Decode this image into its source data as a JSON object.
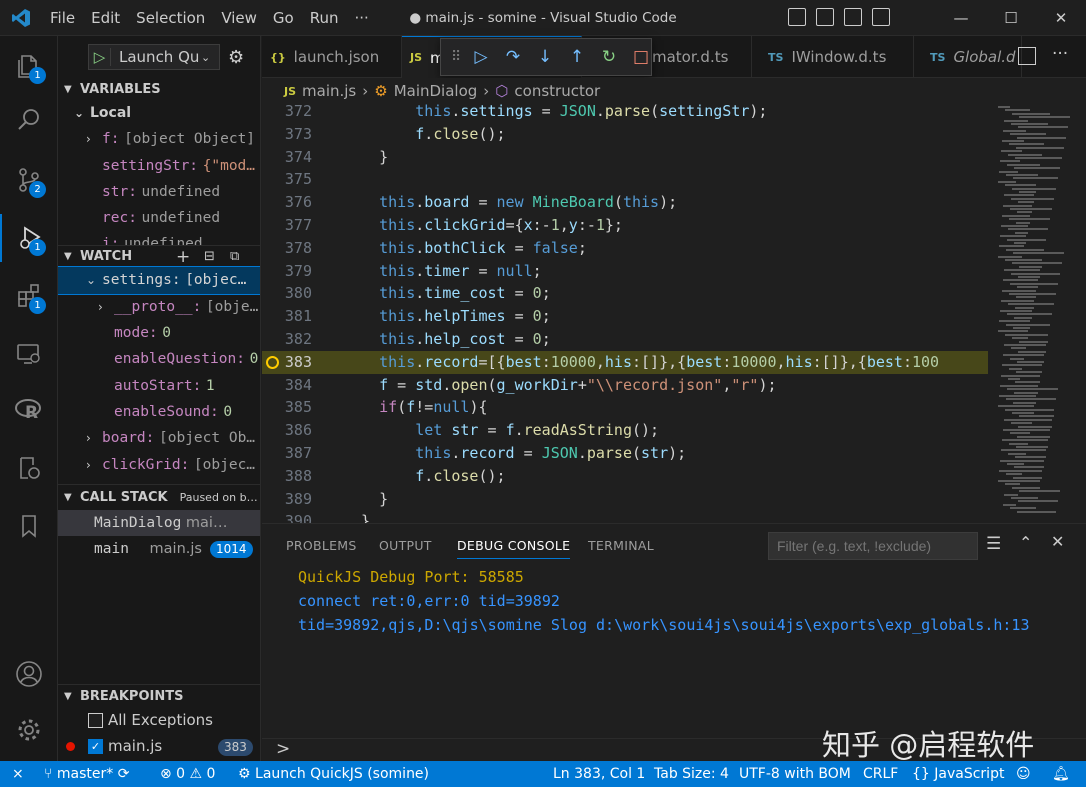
{
  "window": {
    "title": "● main.js - somine - Visual Studio Code",
    "menu": [
      "File",
      "Edit",
      "Selection",
      "View",
      "Go",
      "Run",
      "···"
    ]
  },
  "activity": {
    "explorer_badge": "1",
    "scm_badge": "2",
    "debug_badge": "1",
    "extensions_badge": "1"
  },
  "debug": {
    "launch_config": "Launch Qu"
  },
  "variables": {
    "header": "VARIABLES",
    "local_header": "Local",
    "rows": [
      {
        "name": "f:",
        "value": "[object Object]"
      },
      {
        "name": "settingStr:",
        "value": "{\"mod…"
      },
      {
        "name": "str:",
        "value": "undefined"
      },
      {
        "name": "rec:",
        "value": "undefined"
      },
      {
        "name": "i:",
        "value": "undefined"
      }
    ]
  },
  "watch": {
    "header": "WATCH",
    "rows": [
      {
        "name": "settings:",
        "value": "[objec…"
      },
      {
        "name": "__proto__:",
        "value": "[obje…"
      },
      {
        "name": "mode:",
        "value": "0"
      },
      {
        "name": "enableQuestion:",
        "value": "0"
      },
      {
        "name": "autoStart:",
        "value": "1"
      },
      {
        "name": "enableSound:",
        "value": "0"
      },
      {
        "name": "board:",
        "value": "[object Ob…"
      },
      {
        "name": "clickGrid:",
        "value": "[objec…"
      }
    ]
  },
  "callstack": {
    "header": "CALL STACK",
    "status": "Paused on b…",
    "frames": [
      {
        "name": "MainDialog",
        "file": "mai…"
      },
      {
        "name": "main",
        "file": "main.js",
        "line": "1014"
      }
    ]
  },
  "breakpoints": {
    "header": "BREAKPOINTS",
    "all_exceptions": "All Exceptions",
    "file": "main.js",
    "count": "383"
  },
  "tabs": [
    {
      "icon": "{}",
      "label": "launch.json"
    },
    {
      "icon": "JS",
      "label": "main.js"
    },
    {
      "icon": "",
      "label": "mator.d.ts"
    },
    {
      "icon": "TS",
      "label": "IWindow.d.ts"
    },
    {
      "icon": "TS",
      "label": "Global.d"
    }
  ],
  "breadcrumb": {
    "file_icon": "JS",
    "file": "main.js",
    "class": "MainDialog",
    "member": "constructor"
  },
  "code_lines": [
    {
      "n": "372",
      "tokens": [
        [
          "plain",
          "        "
        ],
        [
          "k",
          "this"
        ],
        [
          "plain",
          "."
        ],
        [
          "prop",
          "settings"
        ],
        [
          "plain",
          " = "
        ],
        [
          "cls",
          "JSON"
        ],
        [
          "plain",
          "."
        ],
        [
          "fn",
          "parse"
        ],
        [
          "plain",
          "("
        ],
        [
          "prop",
          "settingStr"
        ],
        [
          "plain",
          ");"
        ]
      ]
    },
    {
      "n": "373",
      "tokens": [
        [
          "plain",
          "        "
        ],
        [
          "prop",
          "f"
        ],
        [
          "plain",
          "."
        ],
        [
          "fn",
          "close"
        ],
        [
          "plain",
          "();"
        ]
      ]
    },
    {
      "n": "374",
      "tokens": [
        [
          "plain",
          "    }"
        ]
      ]
    },
    {
      "n": "375",
      "tokens": [
        [
          "plain",
          ""
        ]
      ]
    },
    {
      "n": "376",
      "tokens": [
        [
          "plain",
          "    "
        ],
        [
          "k",
          "this"
        ],
        [
          "plain",
          "."
        ],
        [
          "prop",
          "board"
        ],
        [
          "plain",
          " = "
        ],
        [
          "k",
          "new"
        ],
        [
          "plain",
          " "
        ],
        [
          "cls",
          "MineBoard"
        ],
        [
          "plain",
          "("
        ],
        [
          "k",
          "this"
        ],
        [
          "plain",
          ");"
        ]
      ]
    },
    {
      "n": "377",
      "tokens": [
        [
          "plain",
          "    "
        ],
        [
          "k",
          "this"
        ],
        [
          "plain",
          "."
        ],
        [
          "prop",
          "clickGrid"
        ],
        [
          "plain",
          "={"
        ],
        [
          "prop",
          "x"
        ],
        [
          "plain",
          ":-"
        ],
        [
          "num",
          "1"
        ],
        [
          "plain",
          ","
        ],
        [
          "prop",
          "y"
        ],
        [
          "plain",
          ":-"
        ],
        [
          "num",
          "1"
        ],
        [
          "plain",
          "};"
        ]
      ]
    },
    {
      "n": "378",
      "tokens": [
        [
          "plain",
          "    "
        ],
        [
          "k",
          "this"
        ],
        [
          "plain",
          "."
        ],
        [
          "prop",
          "bothClick"
        ],
        [
          "plain",
          " = "
        ],
        [
          "k",
          "false"
        ],
        [
          "plain",
          ";"
        ]
      ]
    },
    {
      "n": "379",
      "tokens": [
        [
          "plain",
          "    "
        ],
        [
          "k",
          "this"
        ],
        [
          "plain",
          "."
        ],
        [
          "prop",
          "timer"
        ],
        [
          "plain",
          " = "
        ],
        [
          "k",
          "null"
        ],
        [
          "plain",
          ";"
        ]
      ]
    },
    {
      "n": "380",
      "tokens": [
        [
          "plain",
          "    "
        ],
        [
          "k",
          "this"
        ],
        [
          "plain",
          "."
        ],
        [
          "prop",
          "time_cost"
        ],
        [
          "plain",
          " = "
        ],
        [
          "num",
          "0"
        ],
        [
          "plain",
          ";"
        ]
      ]
    },
    {
      "n": "381",
      "tokens": [
        [
          "plain",
          "    "
        ],
        [
          "k",
          "this"
        ],
        [
          "plain",
          "."
        ],
        [
          "prop",
          "helpTimes"
        ],
        [
          "plain",
          " = "
        ],
        [
          "num",
          "0"
        ],
        [
          "plain",
          ";"
        ]
      ]
    },
    {
      "n": "382",
      "tokens": [
        [
          "plain",
          "    "
        ],
        [
          "k",
          "this"
        ],
        [
          "plain",
          "."
        ],
        [
          "prop",
          "help_cost"
        ],
        [
          "plain",
          " = "
        ],
        [
          "num",
          "0"
        ],
        [
          "plain",
          ";"
        ]
      ]
    },
    {
      "n": "383",
      "current": true,
      "tokens": [
        [
          "plain",
          "    "
        ],
        [
          "k",
          "this"
        ],
        [
          "plain",
          "."
        ],
        [
          "prop",
          "record"
        ],
        [
          "plain",
          "=[{"
        ],
        [
          "prop",
          "best"
        ],
        [
          "plain",
          ":"
        ],
        [
          "num",
          "10000"
        ],
        [
          "plain",
          ","
        ],
        [
          "prop",
          "his"
        ],
        [
          "plain",
          ":[]},{"
        ],
        [
          "prop",
          "best"
        ],
        [
          "plain",
          ":"
        ],
        [
          "num",
          "10000"
        ],
        [
          "plain",
          ","
        ],
        [
          "prop",
          "his"
        ],
        [
          "plain",
          ":[]},{"
        ],
        [
          "prop",
          "best"
        ],
        [
          "plain",
          ":"
        ],
        [
          "num",
          "100"
        ]
      ]
    },
    {
      "n": "384",
      "tokens": [
        [
          "plain",
          "    "
        ],
        [
          "prop",
          "f"
        ],
        [
          "plain",
          " = "
        ],
        [
          "prop",
          "std"
        ],
        [
          "plain",
          "."
        ],
        [
          "fn",
          "open"
        ],
        [
          "plain",
          "("
        ],
        [
          "prop",
          "g_workDir"
        ],
        [
          "plain",
          "+"
        ],
        [
          "str",
          "\"\\\\record.json\""
        ],
        [
          "plain",
          ","
        ],
        [
          "str",
          "\"r\""
        ],
        [
          "plain",
          ");"
        ]
      ]
    },
    {
      "n": "385",
      "tokens": [
        [
          "plain",
          "    "
        ],
        [
          "c",
          "if"
        ],
        [
          "plain",
          "("
        ],
        [
          "prop",
          "f"
        ],
        [
          "plain",
          "!="
        ],
        [
          "k",
          "null"
        ],
        [
          "plain",
          "){"
        ]
      ]
    },
    {
      "n": "386",
      "tokens": [
        [
          "plain",
          "        "
        ],
        [
          "k",
          "let"
        ],
        [
          "plain",
          " "
        ],
        [
          "prop",
          "str"
        ],
        [
          "plain",
          " = "
        ],
        [
          "prop",
          "f"
        ],
        [
          "plain",
          "."
        ],
        [
          "fn",
          "readAsString"
        ],
        [
          "plain",
          "();"
        ]
      ]
    },
    {
      "n": "387",
      "tokens": [
        [
          "plain",
          "        "
        ],
        [
          "k",
          "this"
        ],
        [
          "plain",
          "."
        ],
        [
          "prop",
          "record"
        ],
        [
          "plain",
          " = "
        ],
        [
          "cls",
          "JSON"
        ],
        [
          "plain",
          "."
        ],
        [
          "fn",
          "parse"
        ],
        [
          "plain",
          "("
        ],
        [
          "prop",
          "str"
        ],
        [
          "plain",
          ");"
        ]
      ]
    },
    {
      "n": "388",
      "tokens": [
        [
          "plain",
          "        "
        ],
        [
          "prop",
          "f"
        ],
        [
          "plain",
          "."
        ],
        [
          "fn",
          "close"
        ],
        [
          "plain",
          "();"
        ]
      ]
    },
    {
      "n": "389",
      "tokens": [
        [
          "plain",
          "    }"
        ]
      ]
    },
    {
      "n": "390",
      "tokens": [
        [
          "plain",
          "  }"
        ]
      ]
    }
  ],
  "panel": {
    "tabs": [
      "PROBLEMS",
      "OUTPUT",
      "DEBUG CONSOLE",
      "TERMINAL"
    ],
    "filter_placeholder": "Filter (e.g. text, !exclude)",
    "console": [
      "QuickJS Debug Port: 58585",
      "connect ret:0,err:0 tid=39892",
      "tid=39892,qjs,D:\\qjs\\somine Slog d:\\work\\soui4js\\soui4js\\exports\\exp_globals.h:13"
    ],
    "prompt": ">",
    "watermark": "知乎 @启程软件"
  },
  "status": {
    "branch": "master*",
    "problems": "⊗ 0 ⚠ 0",
    "launch": "Launch QuickJS (somine)",
    "position": "Ln 383, Col 1",
    "tab_size": "Tab Size: 4",
    "encoding": "UTF-8 with BOM",
    "eol": "CRLF",
    "language": "JavaScript"
  }
}
